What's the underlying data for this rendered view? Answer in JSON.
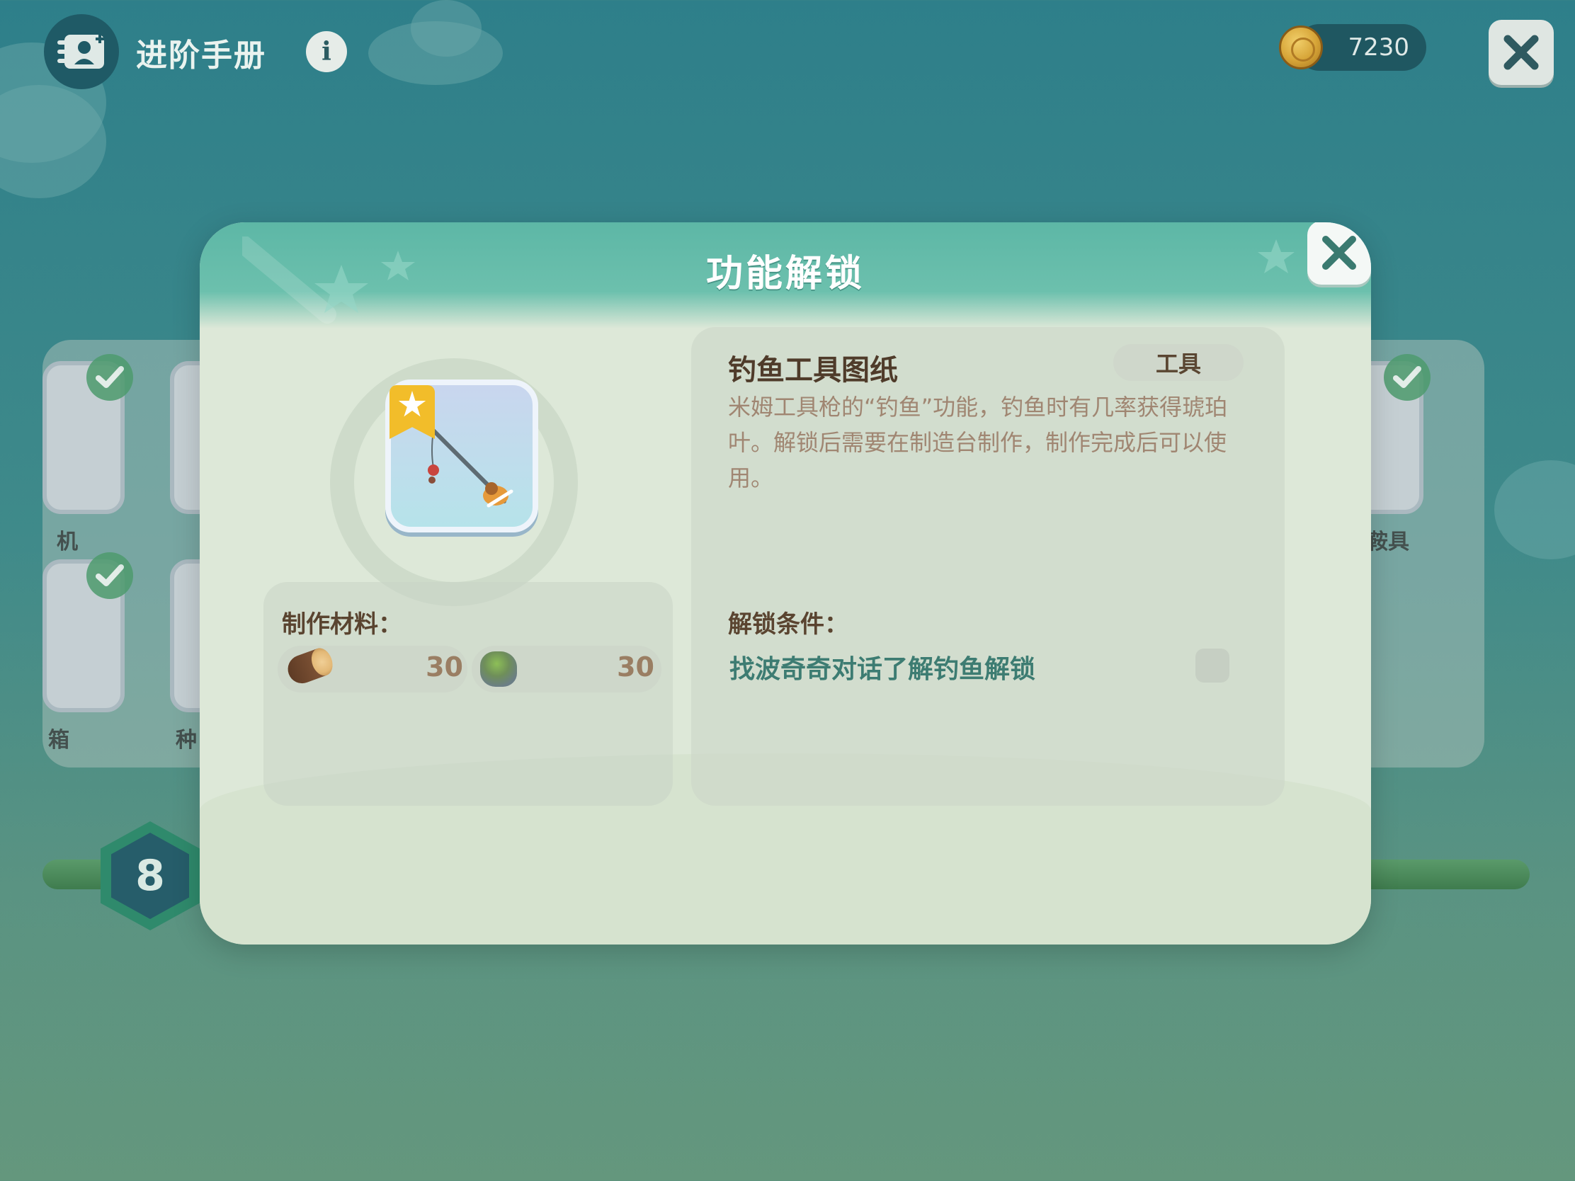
{
  "header": {
    "title": "进阶手册",
    "icons": {
      "handbook": "handbook-icon",
      "info": "info-icon",
      "coin": "coin-icon",
      "close": "close-icon"
    },
    "info_label": "i",
    "coins": "7230"
  },
  "background": {
    "left_labels": [
      "机",
      "箱",
      "种"
    ],
    "right_labels": [
      "鞍具"
    ],
    "level": "8"
  },
  "modal": {
    "title": "功能解锁",
    "item": {
      "name": "钓鱼工具图纸",
      "tag": "工具",
      "description": "米姆工具枪的“钓鱼”功能，钓鱼时有几率获得琥珀叶。解锁后需要在制造台制作，制作完成后可以使用。"
    },
    "materials": {
      "title": "制作材料：",
      "items": [
        {
          "icon": "wood-log-icon",
          "count": "30"
        },
        {
          "icon": "stone-icon",
          "count": "30"
        }
      ]
    },
    "conditions": {
      "title": "解锁条件：",
      "items": [
        {
          "text": "找波奇奇对话了解钓鱼解锁",
          "done": false
        }
      ]
    }
  },
  "colors": {
    "header_teal": "#5db7a6",
    "condition_text": "#3d7c72",
    "coin_gold": "#d6a437"
  }
}
